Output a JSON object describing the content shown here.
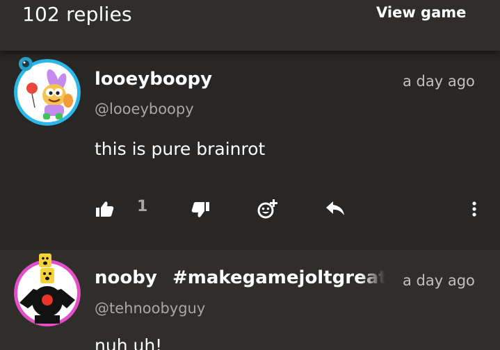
{
  "header": {
    "reply_count": "102 replies",
    "view_game_label": "View game"
  },
  "comments": [
    {
      "username": "looeyboopy",
      "handle": "@looeyboopy",
      "time": "a day ago",
      "text": "this is pure brainrot",
      "like_count": "1",
      "avatar_ring_color": "#2bb7e8"
    },
    {
      "username": "nooby",
      "hashtag": "#makegamejoltgreat",
      "handle": "@tehnoobyguy",
      "time": "a day ago",
      "text": "nuh uh!",
      "avatar_ring_color": "#e24fc6"
    }
  ],
  "icons": {
    "like": "thumbs-up-icon",
    "dislike": "thumbs-down-icon",
    "reaction": "add-reaction-icon",
    "reply": "reply-icon",
    "more": "more-vertical-icon"
  }
}
